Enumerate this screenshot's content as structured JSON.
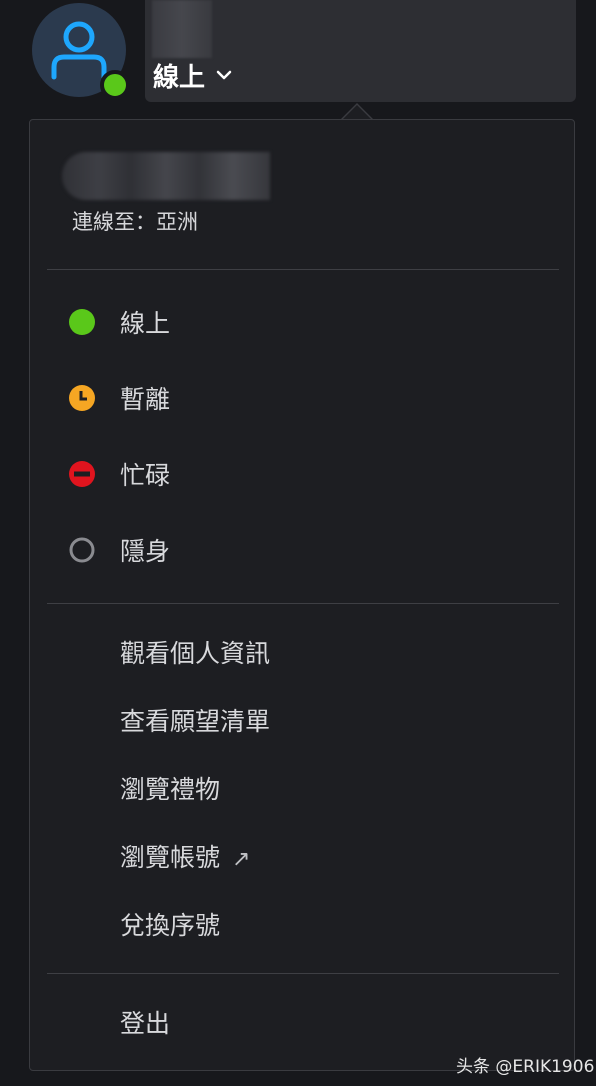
{
  "header": {
    "status_label": "線上"
  },
  "menu": {
    "region_text": "連線至：亞洲",
    "statuses": [
      {
        "label": "線上",
        "icon": "online-dot-icon",
        "color": "#5ac81a"
      },
      {
        "label": "暫離",
        "icon": "away-clock-icon",
        "color": "#f5a623"
      },
      {
        "label": "忙碌",
        "icon": "busy-minus-icon",
        "color": "#e0141e"
      },
      {
        "label": "隱身",
        "icon": "invisible-ring-icon",
        "color": "#8a8b90"
      }
    ],
    "actions": [
      {
        "label": "觀看個人資訊"
      },
      {
        "label": "查看願望清單"
      },
      {
        "label": "瀏覽禮物"
      },
      {
        "label": "瀏覽帳號",
        "external_icon": "↗"
      },
      {
        "label": "兌換序號"
      }
    ],
    "logout_label": "登出"
  },
  "watermark": "头条 @ERIK1906"
}
